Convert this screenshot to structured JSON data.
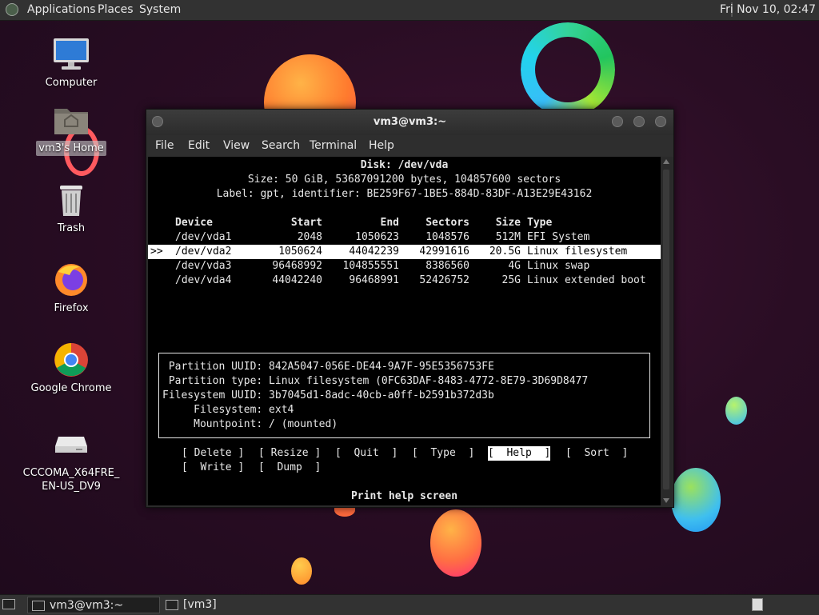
{
  "top_panel": {
    "menus": [
      "Applications",
      "Places",
      "System"
    ],
    "clock": "Fri Nov 10, 02:47"
  },
  "desktop_icons": [
    {
      "label": "Computer",
      "icon": "computer-icon"
    },
    {
      "label": "vm3's Home",
      "icon": "home-folder-icon",
      "selected": true
    },
    {
      "label": "Trash",
      "icon": "trash-icon"
    },
    {
      "label": "Firefox",
      "icon": "firefox-icon"
    },
    {
      "label": "Google Chrome",
      "icon": "chrome-icon"
    },
    {
      "label": "CCCOMA_X64FRE_\nEN-US_DV9",
      "icon": "optical-drive-icon"
    }
  ],
  "window": {
    "title": "vm3@vm3:~",
    "menu": [
      "File",
      "Edit",
      "View",
      "Search",
      "Terminal",
      "Help"
    ]
  },
  "cfdisk": {
    "disk_line": "Disk: /dev/vda",
    "size_line": "Size: 50 GiB, 53687091200 bytes, 104857600 sectors",
    "label_line": "Label: gpt, identifier: BE259F67-1BE5-884D-83DF-A13E29E43162",
    "headers": {
      "device": "Device",
      "start": "Start",
      "end": "End",
      "sectors": "Sectors",
      "size": "Size",
      "type": "Type"
    },
    "cursor": ">>",
    "partitions": [
      {
        "device": "/dev/vda1",
        "start": "2048",
        "end": "1050623",
        "sectors": "1048576",
        "size": "512M",
        "type": "EFI System"
      },
      {
        "device": "/dev/vda2",
        "start": "1050624",
        "end": "44042239",
        "sectors": "42991616",
        "size": "20.5G",
        "type": "Linux filesystem",
        "selected": true
      },
      {
        "device": "/dev/vda3",
        "start": "96468992",
        "end": "104855551",
        "sectors": "8386560",
        "size": "4G",
        "type": "Linux swap"
      },
      {
        "device": "/dev/vda4",
        "start": "44042240",
        "end": "96468991",
        "sectors": "52426752",
        "size": "25G",
        "type": "Linux extended boot"
      }
    ],
    "info": [
      " Partition UUID: 842A5047-056E-DE44-9A7F-95E5356753FE",
      " Partition type: Linux filesystem (0FC63DAF-8483-4772-8E79-3D69D8477",
      "Filesystem UUID: 3b7045d1-8adc-40cb-a0ff-b2591b372d3b",
      "     Filesystem: ext4",
      "     Mountpoint: / (mounted)"
    ],
    "buttons_row1": [
      "[ Delete ]",
      "[ Resize ]",
      "[  Quit  ]",
      "[  Type  ]",
      "[  Help  ]",
      "[  Sort  ]"
    ],
    "buttons_row2": [
      "[  Write ]",
      "[  Dump  ]"
    ],
    "active_button": "Help",
    "status": "Print help screen"
  },
  "bottom_panel": {
    "tasks": [
      "vm3@vm3:~",
      "[vm3]"
    ]
  }
}
